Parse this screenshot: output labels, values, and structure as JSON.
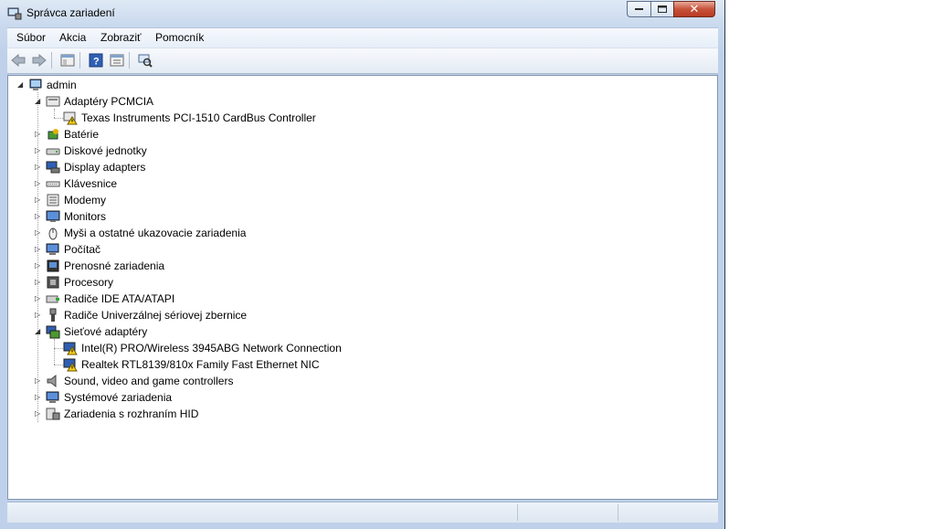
{
  "window": {
    "title": "Správca zariadení"
  },
  "caption": {
    "minimize": "",
    "maximize": "",
    "close": "✕"
  },
  "menu": [
    "Súbor",
    "Akcia",
    "Zobraziť",
    "Pomocník"
  ],
  "toolbar": {
    "icons": [
      "back-arrow-icon",
      "forward-arrow-icon",
      "show-hide-console-tree-icon",
      "help-icon",
      "properties-icon",
      "scan-hardware-changes-icon"
    ]
  },
  "tree": {
    "root": "admin",
    "items": [
      {
        "label": "Adaptéry PCMCIA",
        "icon": "pcmcia-icon",
        "expanded": true,
        "children": [
          {
            "label": "Texas Instruments PCI-1510 CardBus Controller",
            "icon": "warning-device-icon"
          }
        ]
      },
      {
        "label": "Batérie",
        "icon": "battery-icon"
      },
      {
        "label": "Diskové jednotky",
        "icon": "disk-drive-icon"
      },
      {
        "label": "Display adapters",
        "icon": "display-adapter-icon"
      },
      {
        "label": "Klávesnice",
        "icon": "keyboard-icon"
      },
      {
        "label": "Modemy",
        "icon": "modem-icon"
      },
      {
        "label": "Monitors",
        "icon": "monitor-icon"
      },
      {
        "label": "Myši a ostatné ukazovacie zariadenia",
        "icon": "mouse-icon"
      },
      {
        "label": "Počítač",
        "icon": "computer-icon"
      },
      {
        "label": "Prenosné zariadenia",
        "icon": "portable-device-icon"
      },
      {
        "label": "Procesory",
        "icon": "processor-icon"
      },
      {
        "label": "Radiče IDE ATA/ATAPI",
        "icon": "ide-controller-icon"
      },
      {
        "label": "Radiče Univerzálnej sériovej zbernice",
        "icon": "usb-icon"
      },
      {
        "label": "Sieťové adaptéry",
        "icon": "network-adapter-icon",
        "expanded": true,
        "children": [
          {
            "label": "Intel(R) PRO/Wireless 3945ABG Network Connection",
            "icon": "warning-device-icon"
          },
          {
            "label": "Realtek RTL8139/810x Family Fast Ethernet NIC",
            "icon": "warning-device-icon"
          }
        ]
      },
      {
        "label": "Sound, video and game controllers",
        "icon": "sound-icon"
      },
      {
        "label": "Systémové zariadenia",
        "icon": "system-device-icon"
      },
      {
        "label": "Zariadenia s rozhraním HID",
        "icon": "hid-icon"
      }
    ]
  },
  "status": {
    "pane1": "",
    "pane2": "",
    "pane3": ""
  }
}
